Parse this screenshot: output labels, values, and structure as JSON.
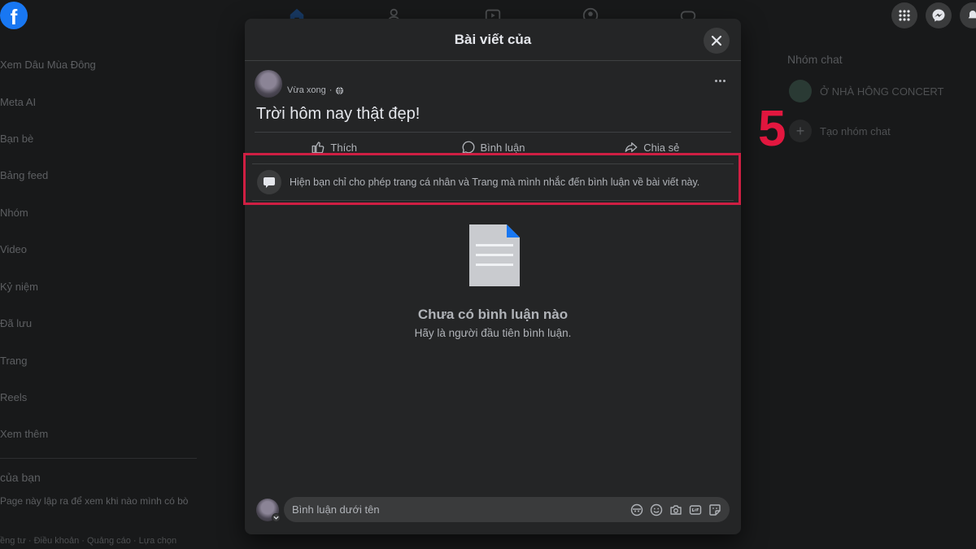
{
  "colors": {
    "accent": "#1877f2",
    "highlight": "#cf1f43",
    "step_number": "#e3173f"
  },
  "background": {
    "left_nav": {
      "items": [
        "Xem Dâu Mùa Đông",
        "Meta AI",
        "Bạn bè",
        "Bảng feed",
        "Nhóm",
        "Video",
        "Kỷ niệm",
        "Đã lưu",
        "Trang",
        "Reels",
        "Xem thêm"
      ],
      "section_title": "của bạn",
      "promo_text": "Page này lập ra để xem khi nào mình có bò",
      "footer": "ềng tư · Điều khoản · Quảng cáo · Lựa chọn"
    },
    "right_col": {
      "title": "Nhóm chat",
      "group_name": "Ở NHÀ HÔNG CONCERT",
      "create_label": "Tạo nhóm chat"
    }
  },
  "step_number": "5",
  "modal": {
    "title": "Bài viết của",
    "post": {
      "time": "Vừa xong",
      "privacy_icon": "globe-icon",
      "text": "Trời hôm nay thật đẹp!"
    },
    "actions": {
      "like": "Thích",
      "comment": "Bình luận",
      "share": "Chia sẻ"
    },
    "notice": "Hiện bạn chỉ cho phép trang cá nhân và Trang mà mình nhắc đến bình luận về bài viết này.",
    "empty_state": {
      "title": "Chưa có bình luận nào",
      "subtitle": "Hãy là người đầu tiên bình luận."
    },
    "composer": {
      "placeholder": "Bình luận dưới tên",
      "icons": [
        "avatar-sticker-icon",
        "emoji-icon",
        "camera-icon",
        "gif-icon",
        "sticker-icon"
      ]
    }
  }
}
